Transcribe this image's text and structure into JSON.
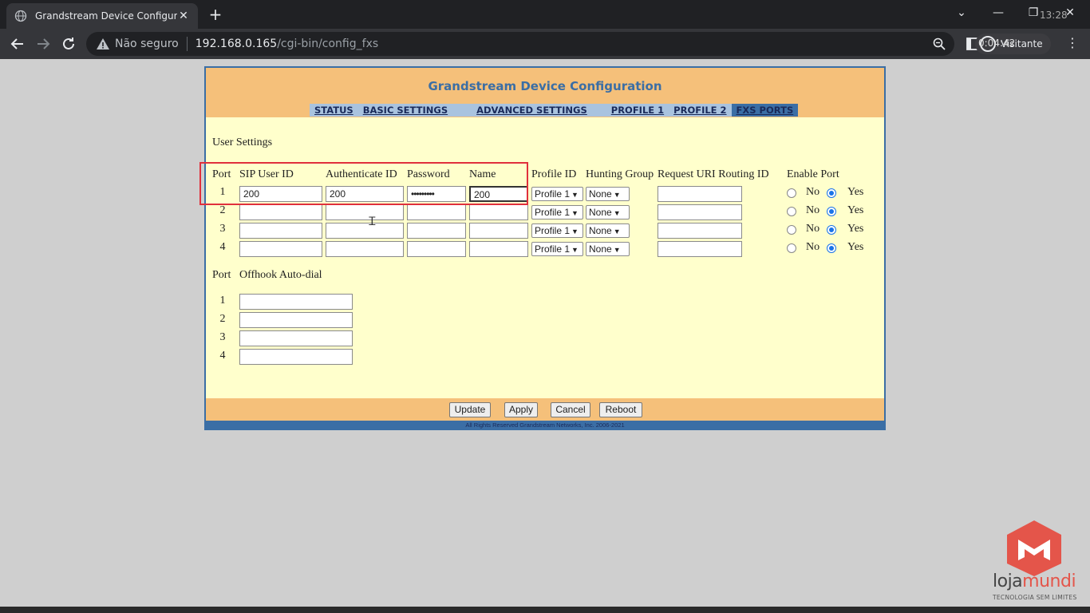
{
  "browser": {
    "tab_title": "Grandstream Device Configuratio",
    "new_tab": "+",
    "clock": "13:28",
    "security_label": "Não seguro",
    "url_host": "192.168.0.165",
    "url_path": "/cgi-bin/config_fxs",
    "profile_label": "Visitante",
    "recording_time": "0:04:42",
    "window": {
      "minimize": "—",
      "restore": "❐",
      "close": "✕",
      "dropdown": "⌄"
    }
  },
  "page": {
    "title": "Grandstream Device Configuration",
    "nav": [
      {
        "label": "STATUS",
        "active": false
      },
      {
        "label": "BASIC SETTINGS",
        "active": false
      },
      {
        "label": "ADVANCED SETTINGS",
        "active": false
      },
      {
        "label": "PROFILE 1",
        "active": false
      },
      {
        "label": "PROFILE 2",
        "active": false
      },
      {
        "label": "FXS PORTS",
        "active": true
      }
    ],
    "user_settings": {
      "title": "User Settings",
      "headers": {
        "port": "Port",
        "sip_user_id": "SIP User ID",
        "auth_id": "Authenticate ID",
        "password": "Password",
        "name": "Name",
        "profile_id": "Profile ID",
        "hunting_group": "Hunting Group",
        "request_uri": "Request URI Routing ID",
        "enable_port": "Enable Port"
      },
      "rows": [
        {
          "port": "1",
          "sip_user_id": "200",
          "auth_id": "200",
          "password": "•••••••••",
          "name": "200",
          "profile": "Profile 1",
          "hunting": "None",
          "request_uri": "",
          "enabled": "Yes"
        },
        {
          "port": "2",
          "sip_user_id": "",
          "auth_id": "",
          "password": "",
          "name": "",
          "profile": "Profile 1",
          "hunting": "None",
          "request_uri": "",
          "enabled": "Yes"
        },
        {
          "port": "3",
          "sip_user_id": "",
          "auth_id": "",
          "password": "",
          "name": "",
          "profile": "Profile 1",
          "hunting": "None",
          "request_uri": "",
          "enabled": "Yes"
        },
        {
          "port": "4",
          "sip_user_id": "",
          "auth_id": "",
          "password": "",
          "name": "",
          "profile": "Profile 1",
          "hunting": "None",
          "request_uri": "",
          "enabled": "Yes"
        }
      ],
      "radio_no": "No",
      "radio_yes": "Yes"
    },
    "offhook": {
      "port_header": "Port",
      "header": "Offhook Auto-dial",
      "rows": [
        {
          "port": "1",
          "value": ""
        },
        {
          "port": "2",
          "value": ""
        },
        {
          "port": "3",
          "value": ""
        },
        {
          "port": "4",
          "value": ""
        }
      ]
    },
    "buttons": {
      "update": "Update",
      "apply": "Apply",
      "cancel": "Cancel",
      "reboot": "Reboot"
    },
    "copyright": "All Rights Reserved Grandstream Networks, Inc. 2006-2021"
  },
  "watermark": {
    "brand_a": "loja",
    "brand_b": "mundi",
    "tagline": "TECNOLOGIA SEM LIMITES"
  },
  "colors": {
    "header_bg": "#f5c07a",
    "content_bg": "#ffffcc",
    "accent_blue": "#3b6ea5",
    "highlight_red": "#e0303c",
    "brand_red": "#e4554a"
  }
}
